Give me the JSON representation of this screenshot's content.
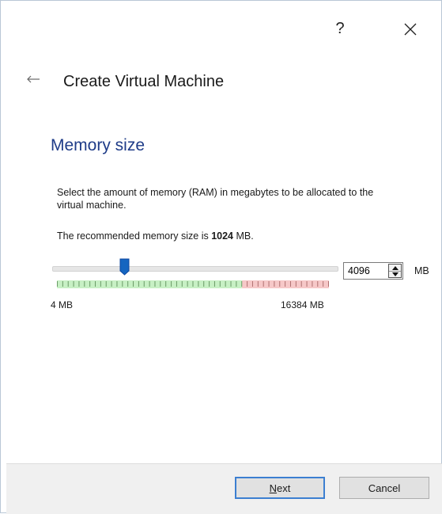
{
  "titlebar": {
    "help_label": "?",
    "close_icon": "close-icon"
  },
  "header": {
    "back_icon": "back-arrow-icon",
    "title": "Create Virtual Machine"
  },
  "section": {
    "title": "Memory size",
    "description": "Select the amount of memory (RAM) in megabytes to be allocated to the virtual machine.",
    "recommend_prefix": "The recommended memory size is ",
    "recommend_value": "1024",
    "recommend_suffix": " MB."
  },
  "memory_slider": {
    "min_label": "4 MB",
    "max_label": "16384 MB",
    "min_mb": 4,
    "max_mb": 16384,
    "value_mb": 4096,
    "recommended_limit_fraction": 0.68
  },
  "memory_input": {
    "value": "4096",
    "unit": "MB"
  },
  "footer": {
    "next_label": "Next",
    "cancel_label": "Cancel"
  },
  "colors": {
    "section_title": "#1f3c88",
    "thumb": "#1565c0",
    "green_zone": "#c7f0c4",
    "red_zone": "#f6c8c8"
  }
}
